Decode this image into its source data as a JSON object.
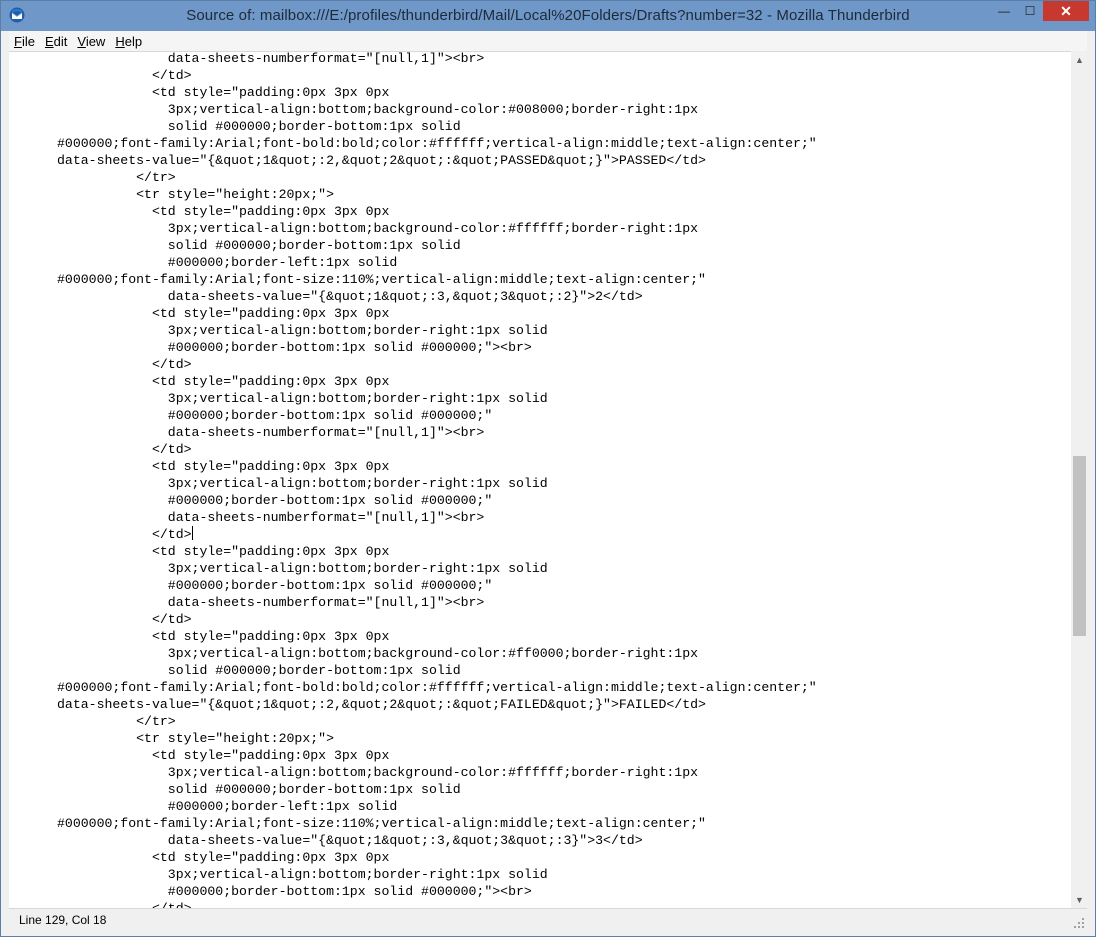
{
  "window": {
    "title": "Source of: mailbox:///E:/profiles/thunderbird/Mail/Local%20Folders/Drafts?number=32 - Mozilla Thunderbird",
    "app_icon": "thunderbird-icon",
    "controls": {
      "minimize": "—",
      "maximize": "☐",
      "close": "✕"
    }
  },
  "menubar": {
    "items": [
      {
        "label": "File",
        "accel": "F",
        "rest": "ile"
      },
      {
        "label": "Edit",
        "accel": "E",
        "rest": "dit"
      },
      {
        "label": "View",
        "accel": "V",
        "rest": "iew"
      },
      {
        "label": "Help",
        "accel": "H",
        "rest": "elp"
      }
    ]
  },
  "source": {
    "lines": [
      "              data-sheets-numberformat=\"[null,1]\"><br>",
      "            </td>",
      "            <td style=\"padding:0px 3px 0px",
      "              3px;vertical-align:bottom;background-color:#008000;border-right:1px",
      "              solid #000000;border-bottom:1px solid",
      "#000000;font-family:Arial;font-bold:bold;color:#ffffff;vertical-align:middle;text-align:center;\"",
      "data-sheets-value=\"{&quot;1&quot;:2,&quot;2&quot;:&quot;PASSED&quot;}\">PASSED</td>",
      "          </tr>",
      "          <tr style=\"height:20px;\">",
      "            <td style=\"padding:0px 3px 0px",
      "              3px;vertical-align:bottom;background-color:#ffffff;border-right:1px",
      "              solid #000000;border-bottom:1px solid",
      "              #000000;border-left:1px solid",
      "#000000;font-family:Arial;font-size:110%;vertical-align:middle;text-align:center;\"",
      "              data-sheets-value=\"{&quot;1&quot;:3,&quot;3&quot;:2}\">2</td>",
      "            <td style=\"padding:0px 3px 0px",
      "              3px;vertical-align:bottom;border-right:1px solid",
      "              #000000;border-bottom:1px solid #000000;\"><br>",
      "            </td>",
      "            <td style=\"padding:0px 3px 0px",
      "              3px;vertical-align:bottom;border-right:1px solid",
      "              #000000;border-bottom:1px solid #000000;\"",
      "              data-sheets-numberformat=\"[null,1]\"><br>",
      "            </td>",
      "            <td style=\"padding:0px 3px 0px",
      "              3px;vertical-align:bottom;border-right:1px solid",
      "              #000000;border-bottom:1px solid #000000;\"",
      "              data-sheets-numberformat=\"[null,1]\"><br>",
      "            </td>",
      "            <td style=\"padding:0px 3px 0px",
      "              3px;vertical-align:bottom;border-right:1px solid",
      "              #000000;border-bottom:1px solid #000000;\"",
      "              data-sheets-numberformat=\"[null,1]\"><br>",
      "            </td>",
      "            <td style=\"padding:0px 3px 0px",
      "              3px;vertical-align:bottom;background-color:#ff0000;border-right:1px",
      "              solid #000000;border-bottom:1px solid",
      "#000000;font-family:Arial;font-bold:bold;color:#ffffff;vertical-align:middle;text-align:center;\"",
      "data-sheets-value=\"{&quot;1&quot;:2,&quot;2&quot;:&quot;FAILED&quot;}\">FAILED</td>",
      "          </tr>",
      "          <tr style=\"height:20px;\">",
      "            <td style=\"padding:0px 3px 0px",
      "              3px;vertical-align:bottom;background-color:#ffffff;border-right:1px",
      "              solid #000000;border-bottom:1px solid",
      "              #000000;border-left:1px solid",
      "#000000;font-family:Arial;font-size:110%;vertical-align:middle;text-align:center;\"",
      "              data-sheets-value=\"{&quot;1&quot;:3,&quot;3&quot;:3}\">3</td>",
      "            <td style=\"padding:0px 3px 0px",
      "              3px;vertical-align:bottom;border-right:1px solid",
      "              #000000;border-bottom:1px solid #000000;\"><br>",
      "            </td>"
    ],
    "caret_line": 28
  },
  "scrollbar": {
    "up_arrow": "▲",
    "down_arrow": "▼"
  },
  "status": {
    "position": "Line 129, Col 18"
  }
}
